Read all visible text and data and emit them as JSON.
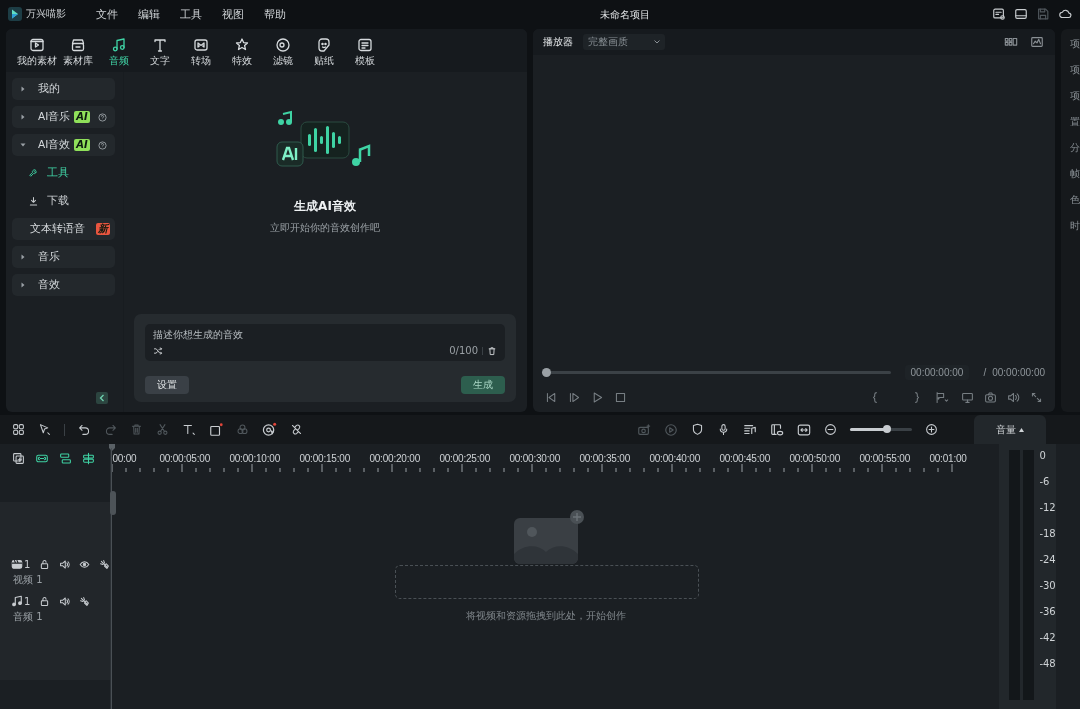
{
  "app": {
    "name": "万兴喵影"
  },
  "menu": [
    "文件",
    "编辑",
    "工具",
    "视图",
    "帮助"
  ],
  "window": {
    "title": "未命名项目"
  },
  "media_tabs": [
    {
      "label": "我的素材",
      "selected": false
    },
    {
      "label": "素材库",
      "selected": false
    },
    {
      "label": "音频",
      "selected": true
    },
    {
      "label": "文字",
      "selected": false
    },
    {
      "label": "转场",
      "selected": false
    },
    {
      "label": "特效",
      "selected": false
    },
    {
      "label": "滤镜",
      "selected": false
    },
    {
      "label": "贴纸",
      "selected": false
    },
    {
      "label": "模板",
      "selected": false
    }
  ],
  "sidebar": {
    "items": [
      {
        "kind": "group",
        "label": "我的",
        "expanded": false
      },
      {
        "kind": "group",
        "label": "AI音乐",
        "badge": {
          "text": "AI",
          "color": "#8fe05a"
        },
        "help": true,
        "expanded": false
      },
      {
        "kind": "group",
        "label": "AI音效",
        "badge": {
          "text": "AI",
          "color": "#8fe05a"
        },
        "help": true,
        "expanded": true,
        "children": [
          {
            "label": "工具",
            "selected": true
          },
          {
            "label": "下载",
            "selected": false
          }
        ]
      },
      {
        "kind": "item",
        "label": "文本转语音",
        "badge": {
          "text": "新",
          "color": "#e8553f"
        }
      },
      {
        "kind": "group",
        "label": "音乐",
        "expanded": false
      },
      {
        "kind": "group",
        "label": "音效",
        "expanded": false
      }
    ]
  },
  "empty_state": {
    "title": "生成AI音效",
    "subtitle": "立即开始你的音效创作吧"
  },
  "prompt": {
    "placeholder": "描述你想生成的音效",
    "counter": "0/100",
    "settings_button": "设置",
    "generate_button": {
      "label": "生成",
      "disabled": true
    }
  },
  "player": {
    "title": "播放器",
    "quality": "完整画质",
    "progress": {
      "level": 0
    },
    "current_time": "00:00:00:00",
    "separator": "/",
    "total_time": "00:00:00:00"
  },
  "right_panel": {
    "header": "项",
    "labels": [
      "项",
      "项",
      "置",
      "分",
      "帧",
      "色",
      "时"
    ]
  },
  "timeline": {
    "ruler": [
      "00:00",
      "00:00:05:00",
      "00:00:10:00",
      "00:00:15:00",
      "00:00:20:00",
      "00:00:25:00",
      "00:00:30:00",
      "00:00:35:00",
      "00:00:40:00",
      "00:00:45:00",
      "00:00:50:00",
      "00:00:55:00",
      "00:01:00"
    ],
    "zoom": {
      "level": 0.6
    },
    "tracks": [
      {
        "kind": "video",
        "number": "1",
        "name": "视频 1"
      },
      {
        "kind": "audio",
        "number": "1",
        "name": "音频 1"
      }
    ],
    "drop_hint": "将视频和资源拖拽到此处，开始创作"
  },
  "volume_meter": {
    "title": "音量",
    "scale": [
      "0",
      "-6",
      "-12",
      "-18",
      "-24",
      "-30",
      "-36",
      "-42",
      "-48"
    ]
  }
}
